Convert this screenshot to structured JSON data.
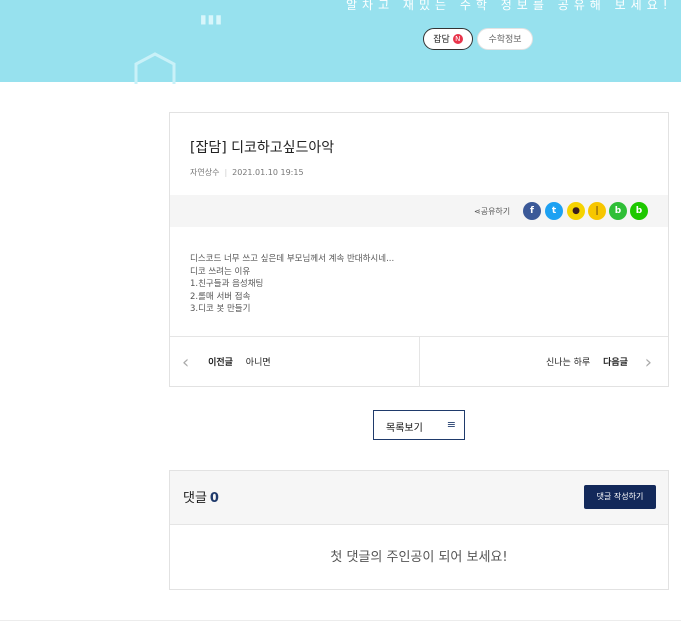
{
  "banner": {
    "subtitle": "알차고 재밌는 수학 정보를 공유해 보세요!",
    "chips": [
      {
        "label": "잡담",
        "badge": "N"
      },
      {
        "label": "수학정보"
      }
    ]
  },
  "post": {
    "title": "[잡담] 디코하고싶드아악",
    "author": "자연상수",
    "date": "2021.01.10 19:15",
    "share_label": "공유하기",
    "share_icons": [
      "facebook-icon",
      "twitter-icon",
      "kakaotalk-icon",
      "kakaostory-icon",
      "band-icon",
      "blog-icon"
    ],
    "body_lines": [
      "디스코드 너무 쓰고 싶은데 부모님께서 계속 반대하시네...",
      "디코 쓰려는 이유",
      "1.친구들과 음성채팅",
      "2.롤매 서버 접속",
      "3.디코 봇 만들기"
    ],
    "prev_label": "이전글",
    "prev_title": "아니면",
    "next_title": "신나는 하루",
    "next_label": "다음글"
  },
  "list_button": {
    "label": "목록보기"
  },
  "comments": {
    "title": "댓글",
    "count": "0",
    "write_button": "댓글 작성하기",
    "empty_message": "첫 댓글의 주인공이 되어 보세요!"
  },
  "colors": {
    "banner_bg": "#97e1ee",
    "accent_navy": "#13295a",
    "badge_red": "#e8334a"
  }
}
